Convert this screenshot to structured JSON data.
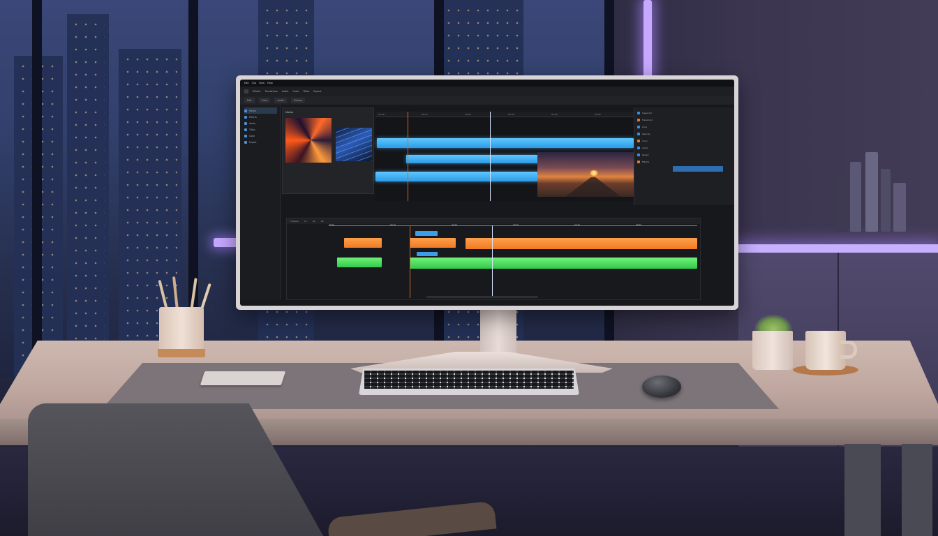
{
  "scene": {
    "description_colors": {
      "accent_neon": "#c6a8ff",
      "clip_blue": "#3aaeff",
      "clip_orange": "#f5862f",
      "clip_green": "#45dd5a"
    }
  },
  "editor": {
    "menu": [
      "Edit",
      "Clip",
      "View",
      "Help"
    ],
    "toolbar": [
      "Effects",
      "Transitions",
      "Audio",
      "Color",
      "Titles",
      "Export"
    ],
    "tabs": [
      "Edit",
      "Color",
      "Audio",
      "Deliver"
    ],
    "left_panel": [
      "Media",
      "Effects",
      "Audio",
      "Titles",
      "Color",
      "Export"
    ],
    "media_panel_title": "Media",
    "top_ruler": [
      "00:00",
      "00:10",
      "00:20",
      "00:30",
      "00:40",
      "00:50"
    ],
    "bottom_header": [
      "Timeline",
      "V1",
      "A1",
      "A2"
    ],
    "bottom_ruler": [
      "00:00",
      "00:10",
      "00:20",
      "00:30",
      "00:40",
      "00:50"
    ],
    "right_panel": [
      "Inspector",
      "Transform",
      "Crop",
      "Opacity",
      "Color",
      "Audio",
      "Speed",
      "Effects"
    ]
  }
}
